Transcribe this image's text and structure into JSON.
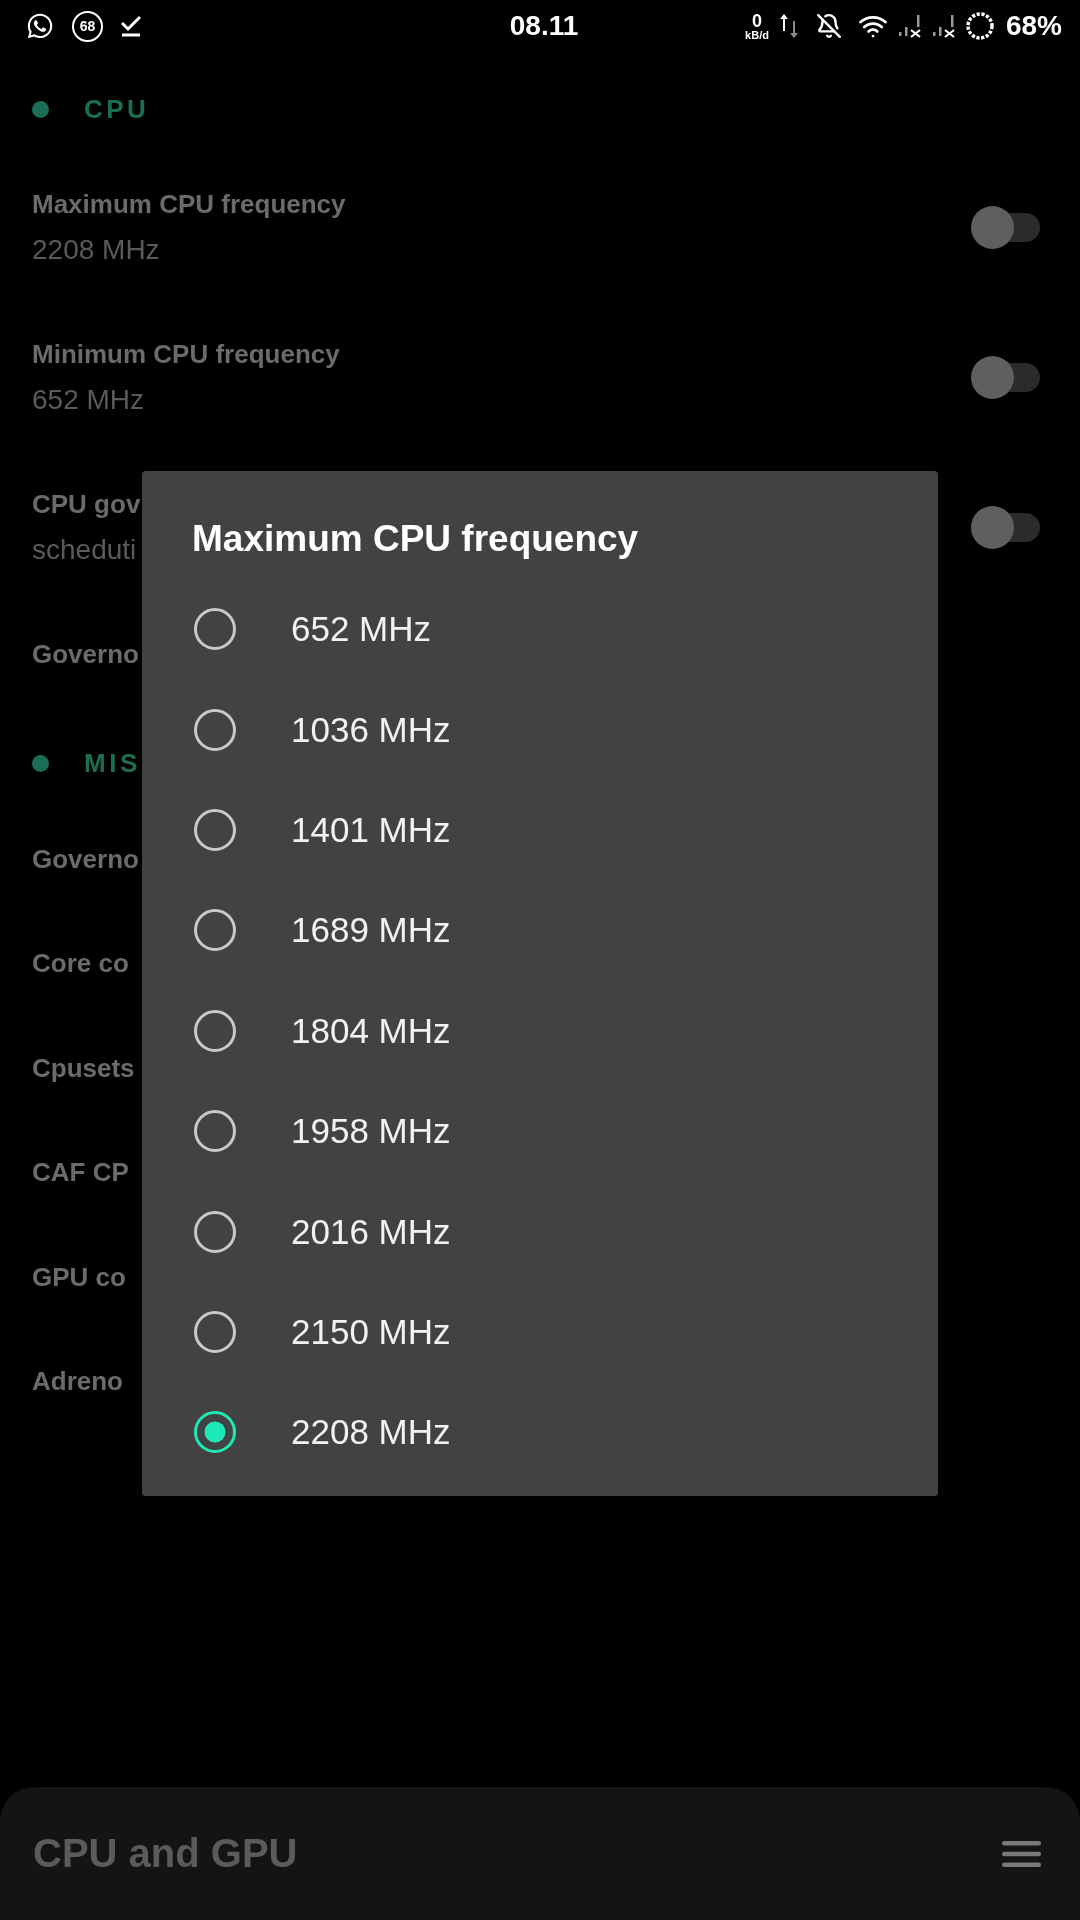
{
  "status_bar": {
    "notification_count": "68",
    "time": "08.11",
    "net_speed": {
      "value": "0",
      "unit": "kB/d"
    },
    "battery": "68%"
  },
  "sections": [
    {
      "title": "CPU",
      "items": [
        {
          "kind": "switch",
          "title": "Maximum CPU frequency",
          "value": "2208 MHz",
          "on": false
        },
        {
          "kind": "switch",
          "title": "Minimum CPU frequency",
          "value": "652 MHz",
          "on": false
        },
        {
          "kind": "switch",
          "title": "CPU gov",
          "value": "scheduti",
          "on": false
        },
        {
          "kind": "plain",
          "title": "Governo"
        }
      ]
    },
    {
      "title": "MIS",
      "items": [
        {
          "kind": "plain",
          "title": "Governo"
        },
        {
          "kind": "plain",
          "title": "Core co"
        },
        {
          "kind": "plain",
          "title": "Cpusets"
        },
        {
          "kind": "plain",
          "title": "CAF CP"
        },
        {
          "kind": "plain",
          "title": "GPU co"
        },
        {
          "kind": "plain",
          "title": "Adreno"
        }
      ]
    }
  ],
  "dialog": {
    "title": "Maximum CPU frequency",
    "options": [
      {
        "label": "652 MHz",
        "selected": false
      },
      {
        "label": "1036 MHz",
        "selected": false
      },
      {
        "label": "1401 MHz",
        "selected": false
      },
      {
        "label": "1689 MHz",
        "selected": false
      },
      {
        "label": "1804 MHz",
        "selected": false
      },
      {
        "label": "1958 MHz",
        "selected": false
      },
      {
        "label": "2016 MHz",
        "selected": false
      },
      {
        "label": "2150 MHz",
        "selected": false
      },
      {
        "label": "2208 MHz",
        "selected": true
      }
    ]
  },
  "bottom_bar": {
    "title": "CPU and GPU"
  }
}
